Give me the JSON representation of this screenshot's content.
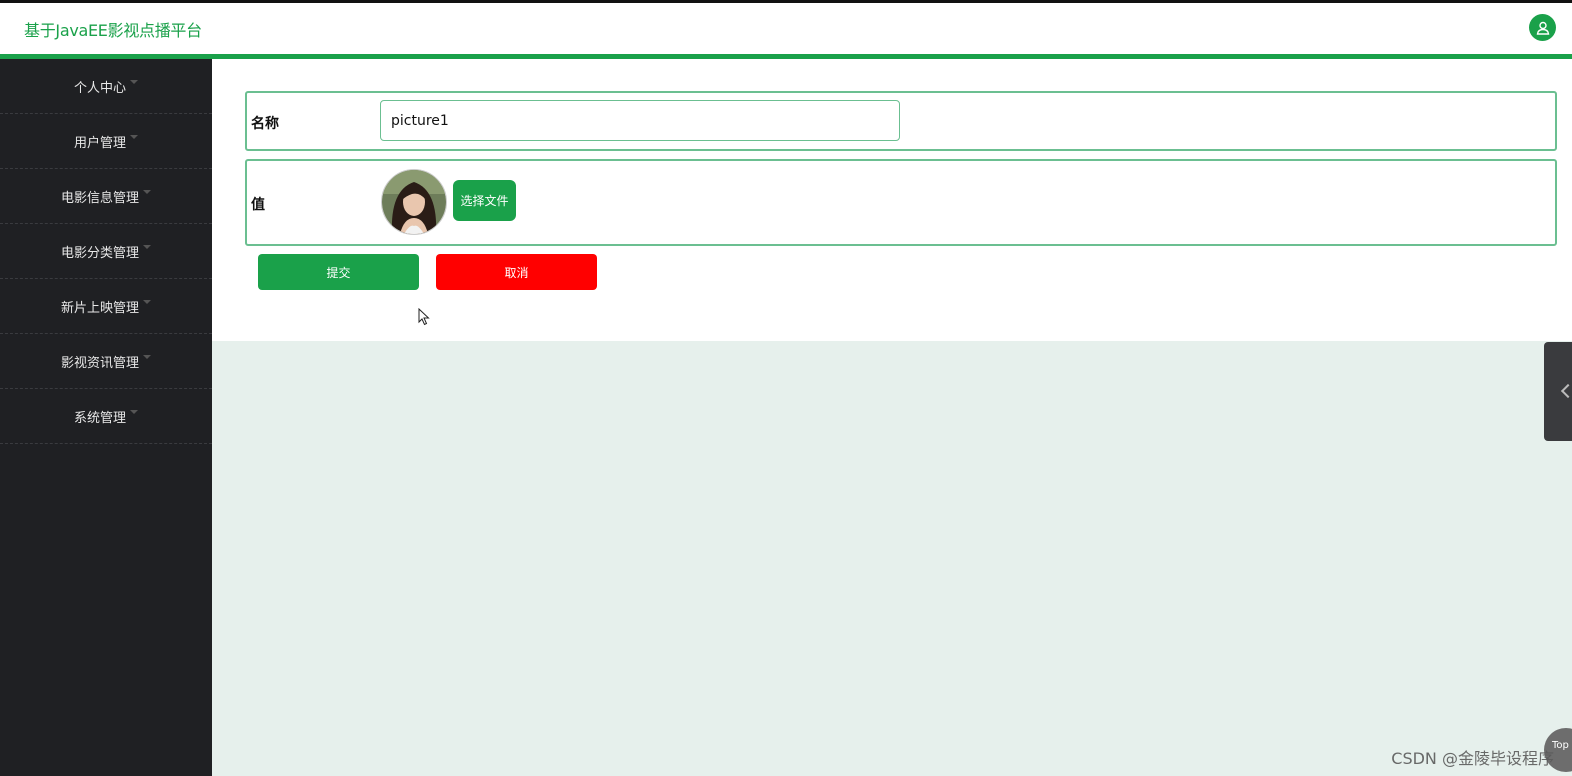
{
  "header": {
    "title": "基于JavaEE影视点播平台",
    "avatar_icon": "user-icon"
  },
  "sidebar": {
    "items": [
      {
        "label": "个人中心"
      },
      {
        "label": "用户管理"
      },
      {
        "label": "电影信息管理"
      },
      {
        "label": "电影分类管理"
      },
      {
        "label": "新片上映管理"
      },
      {
        "label": "影视资讯管理"
      },
      {
        "label": "系统管理"
      }
    ]
  },
  "form": {
    "name_label": "名称",
    "name_value": "picture1",
    "value_label": "值",
    "choose_file_label": "选择文件",
    "submit_label": "提交",
    "cancel_label": "取消"
  },
  "floating": {
    "top_label": "Top"
  },
  "watermark": "CSDN @金陵毕设程序",
  "colors": {
    "accent": "#1aa14a",
    "sidebar_bg": "#1f2023",
    "cancel": "#ff0000",
    "page_bg": "#e6f0ec"
  }
}
